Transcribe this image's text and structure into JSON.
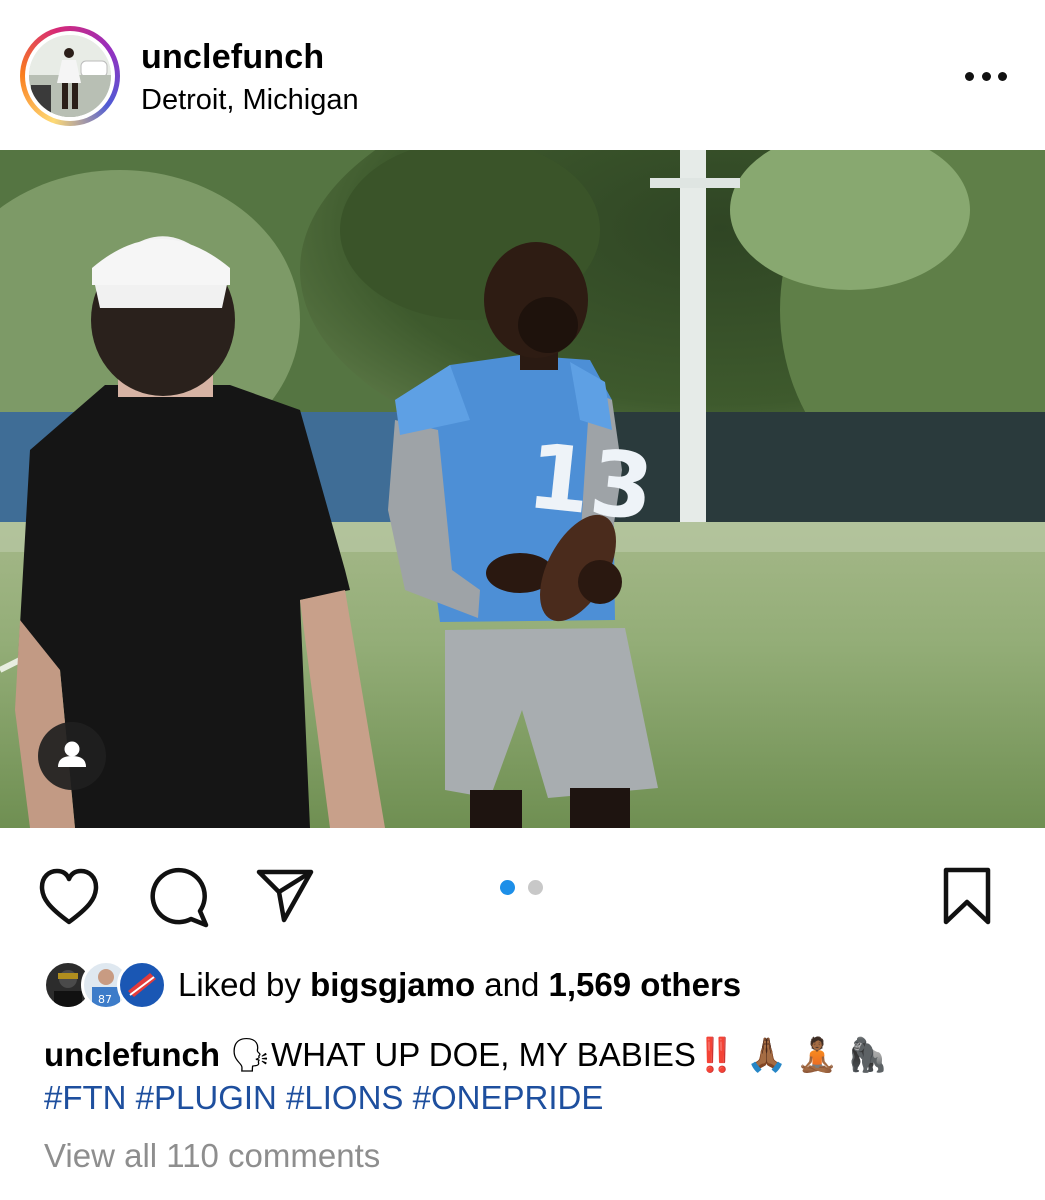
{
  "header": {
    "username": "unclefunch",
    "location": "Detroit, Michigan"
  },
  "post": {
    "carousel": {
      "total": 2,
      "active_index": 0
    },
    "player_jersey_number": "13"
  },
  "likes": {
    "prefix": "Liked by",
    "user": "bigsgjamo",
    "middle": "and",
    "count_text": "1,569 others"
  },
  "caption": {
    "username": "unclefunch",
    "speak_emoji": "🗣",
    "text": "WHAT UP DOE, MY BABIES",
    "bangbang_emoji": "‼️",
    "pray_emoji": "🙏🏾",
    "lotus_emoji": "🧘🏾",
    "gorilla_emoji": "🦍",
    "hashtags": "#FTN #PLUGIN #LIONS #ONEPRIDE"
  },
  "comments": {
    "view_all": "View all 110 comments"
  },
  "colors": {
    "jersey_blue": "#4d8fd6",
    "hashtag_blue": "#1e4f9e",
    "carousel_active": "#1d8fe8",
    "carousel_inactive": "#c8c8c8",
    "muted_text": "#8e8e8e"
  },
  "icons": {
    "more": "more-horizontal-icon",
    "like": "heart-icon",
    "comment": "comment-bubble-icon",
    "share": "paper-plane-icon",
    "save": "bookmark-icon",
    "tags": "person-tag-icon"
  }
}
